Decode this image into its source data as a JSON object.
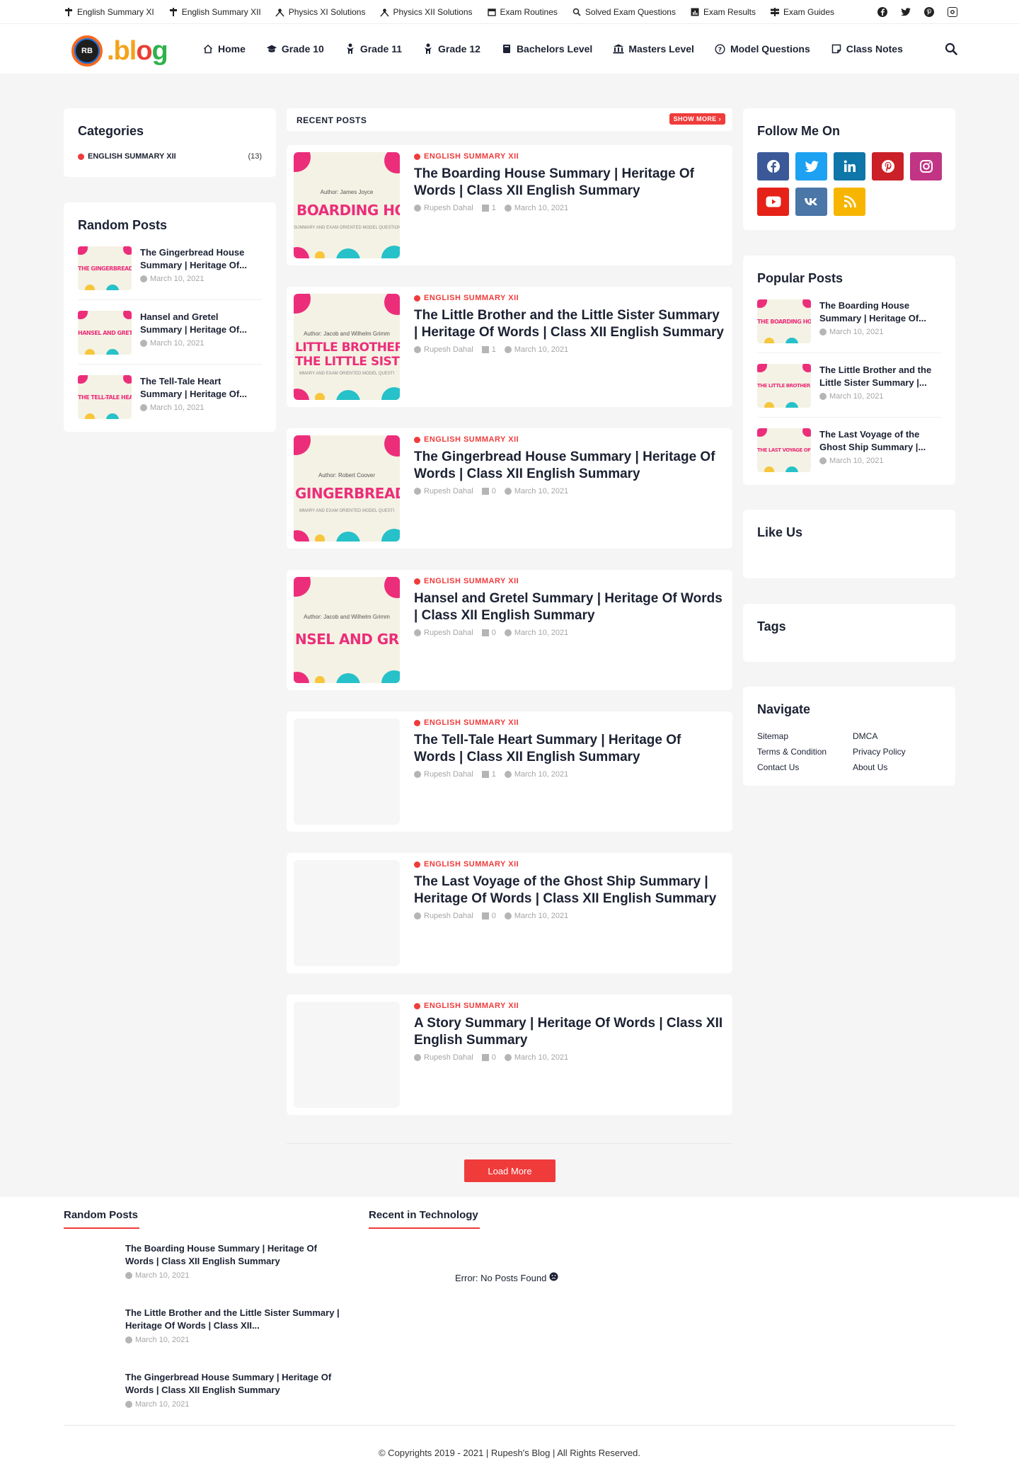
{
  "topbar": {
    "links": [
      {
        "label": "English Summary XI",
        "icon": "signpost-icon"
      },
      {
        "label": "English Summary XII",
        "icon": "signpost-icon"
      },
      {
        "label": "Physics XI Solutions",
        "icon": "atom-icon"
      },
      {
        "label": "Physics XII Solutions",
        "icon": "atom-icon"
      },
      {
        "label": "Exam Routines",
        "icon": "calendar-icon"
      },
      {
        "label": "Solved Exam Questions",
        "icon": "magnifier-icon"
      },
      {
        "label": "Exam Results",
        "icon": "chart-icon"
      },
      {
        "label": "Exam Guides",
        "icon": "signs-icon"
      }
    ],
    "social": [
      "facebook-icon",
      "twitter-icon",
      "pinterest-icon",
      "instagram-icon"
    ]
  },
  "header": {
    "logo_badge": "RB",
    "logo_word_parts": [
      ".bl",
      "o",
      "g"
    ],
    "nav": [
      {
        "label": "Home",
        "icon": "home-icon"
      },
      {
        "label": "Grade 10",
        "icon": "graduation-cap-icon"
      },
      {
        "label": "Grade 11",
        "icon": "person-icon"
      },
      {
        "label": "Grade 12",
        "icon": "person-icon"
      },
      {
        "label": "Bachelors Level",
        "icon": "book-icon"
      },
      {
        "label": "Masters Level",
        "icon": "bank-icon"
      },
      {
        "label": "Model Questions",
        "icon": "question-icon"
      },
      {
        "label": "Class Notes",
        "icon": "note-icon"
      }
    ]
  },
  "left": {
    "categories_title": "Categories",
    "category": {
      "name": "ENGLISH SUMMARY XII",
      "count": "(13)"
    },
    "random_title": "Random Posts",
    "random_posts": [
      {
        "title": "The Gingerbread House Summary | Heritage Of...",
        "date": "March 10, 2021",
        "thumb": "THE GINGERBREAD HOU"
      },
      {
        "title": "Hansel and Gretel Summary | Heritage Of...",
        "date": "March 10, 2021",
        "thumb": "HANSEL AND GRETEL"
      },
      {
        "title": "The Tell-Tale Heart Summary | Heritage Of...",
        "date": "March 10, 2021",
        "thumb": "THE TELL-TALE HEART"
      }
    ]
  },
  "center": {
    "section_label": "RECENT POSTS",
    "show_more": "SHOW MORE ›",
    "posts": [
      {
        "category": "ENGLISH SUMMARY XII",
        "title": "The Boarding House Summary | Heritage Of Words | Class XII English Summary",
        "author": "Rupesh Dahal",
        "comments": "1",
        "date": "March 10, 2021",
        "thumb_author": "Author: James Joyce",
        "thumb_title": "BOARDING HOU",
        "thumb_sub": "SUMMARY AND EXAM ORIENTED MODEL QUESTIONS"
      },
      {
        "category": "ENGLISH SUMMARY XII",
        "title": "The Little Brother and the Little Sister Summary | Heritage Of Words | Class XII English Summary",
        "author": "Rupesh Dahal",
        "comments": "1",
        "date": "March 10, 2021",
        "thumb_author": "Author: Jacob and Wilhelm Grimm",
        "thumb_title": "LITTLE BROTHER",
        "thumb_title2": "THE LITTLE SISTEI",
        "thumb_sub": "MMARY AND EXAM ORIENTED MODEL QUESTI"
      },
      {
        "category": "ENGLISH SUMMARY XII",
        "title": "The Gingerbread House Summary | Heritage Of Words | Class XII English Summary",
        "author": "Rupesh Dahal",
        "comments": "0",
        "date": "March 10, 2021",
        "thumb_author": "Author: Robert Coover",
        "thumb_title": "GINGERBREAD H",
        "thumb_sub": "MMARY AND EXAM ORIENTED MODEL QUESTI"
      },
      {
        "category": "ENGLISH SUMMARY XII",
        "title": "Hansel and Gretel Summary | Heritage Of Words | Class XII English Summary",
        "author": "Rupesh Dahal",
        "comments": "0",
        "date": "March 10, 2021",
        "thumb_author": "Author: Jacob and Wilhelm Grimm",
        "thumb_title": "NSEL AND GRETI",
        "thumb_sub": ""
      },
      {
        "category": "ENGLISH SUMMARY XII",
        "title": "The Tell-Tale Heart Summary | Heritage Of Words | Class XII English Summary",
        "author": "Rupesh Dahal",
        "comments": "1",
        "date": "March 10, 2021"
      },
      {
        "category": "ENGLISH SUMMARY XII",
        "title": "The Last Voyage of the Ghost Ship Summary | Heritage Of Words | Class XII English Summary",
        "author": "Rupesh Dahal",
        "comments": "0",
        "date": "March 10, 2021"
      },
      {
        "category": "ENGLISH SUMMARY XII",
        "title": "A Story Summary | Heritage Of Words | Class XII English Summary",
        "author": "Rupesh Dahal",
        "comments": "0",
        "date": "March 10, 2021"
      }
    ],
    "load_more": "Load More"
  },
  "right": {
    "follow_title": "Follow Me On",
    "follow_icons": [
      {
        "icon": "facebook-icon",
        "color": "#3b5998"
      },
      {
        "icon": "twitter-icon",
        "color": "#1da1f2"
      },
      {
        "icon": "linkedin-icon",
        "color": "#0e76a8"
      },
      {
        "icon": "pinterest-icon",
        "color": "#cb2027"
      },
      {
        "icon": "instagram-icon",
        "color": "#c13584"
      },
      {
        "icon": "youtube-icon",
        "color": "#e62117"
      },
      {
        "icon": "vk-icon",
        "color": "#4a76a8"
      },
      {
        "icon": "rss-icon",
        "color": "#f7b500"
      }
    ],
    "popular_title": "Popular Posts",
    "popular_posts": [
      {
        "title": "The Boarding House Summary | Heritage Of...",
        "date": "March 10, 2021",
        "thumb": "THE BOARDING HOUSE"
      },
      {
        "title": "The Little Brother and the Little Sister Summary |...",
        "date": "March 10, 2021",
        "thumb": "THE LITTLE BROTHER AN"
      },
      {
        "title": "The Last Voyage of the Ghost Ship Summary |...",
        "date": "March 10, 2021",
        "thumb": "THE LAST VOYAGE OF THE"
      }
    ],
    "like_title": "Like Us",
    "tags_title": "Tags",
    "navigate_title": "Navigate",
    "navigate_links": [
      "Sitemap",
      "DMCA",
      "Terms & Condition",
      "Privacy Policy",
      "Contact Us",
      "About Us"
    ]
  },
  "footer": {
    "random_title": "Random Posts",
    "tech_title": "Recent in Technology",
    "posts": [
      {
        "title": "The Boarding House Summary | Heritage Of Words | Class XII English Summary",
        "date": "March 10, 2021"
      },
      {
        "title": "The Little Brother and the Little Sister Summary | Heritage Of Words | Class XII...",
        "date": "March 10, 2021"
      },
      {
        "title": "The Gingerbread House Summary | Heritage Of Words | Class XII English Summary",
        "date": "March 10, 2021"
      }
    ],
    "error_text": "Error: No Posts Found",
    "copyright": "© Copyrights 2019 - 2021 | Rupesh's Blog | All Rights Reserved."
  },
  "colors": {
    "accent": "#f03b3b",
    "text": "#1c2233",
    "muted": "#a5a5a5",
    "background": "#f5f5f6"
  }
}
